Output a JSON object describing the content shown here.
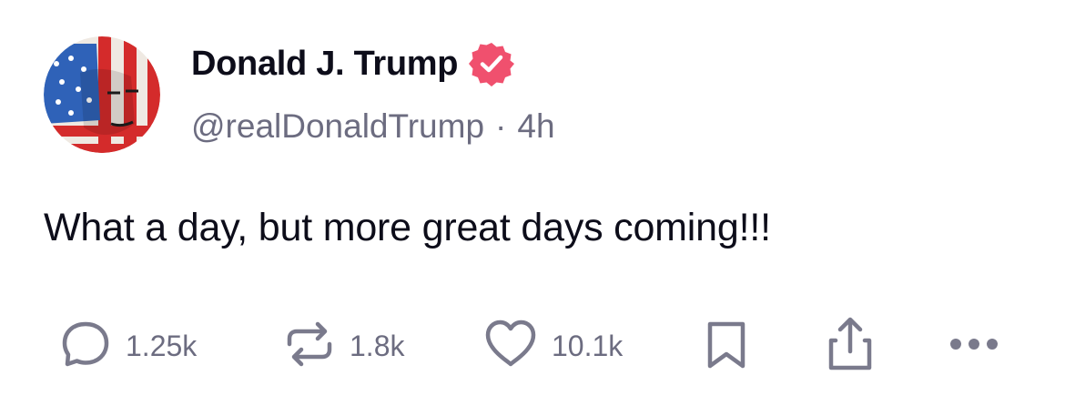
{
  "post": {
    "author": {
      "display_name": "Donald J. Trump",
      "handle": "@realDonaldTrump",
      "verified": true,
      "avatar_icon": "flag-portrait-avatar"
    },
    "separator": "·",
    "time_ago": "4h",
    "text": "What a day, but more great days coming!!!",
    "actions": {
      "reply": {
        "icon": "speech-bubble-icon",
        "count": "1.25k"
      },
      "repost": {
        "icon": "repost-arrows-icon",
        "count": "1.8k"
      },
      "like": {
        "icon": "heart-icon",
        "count": "10.1k"
      },
      "bookmark": {
        "icon": "bookmark-icon"
      },
      "share": {
        "icon": "share-icon"
      },
      "more": {
        "icon": "more-dots-icon"
      }
    }
  },
  "colors": {
    "text": "#0d0d1a",
    "muted": "#6c6c80",
    "icon": "#7a7a8c",
    "verified": "#f0506e"
  }
}
